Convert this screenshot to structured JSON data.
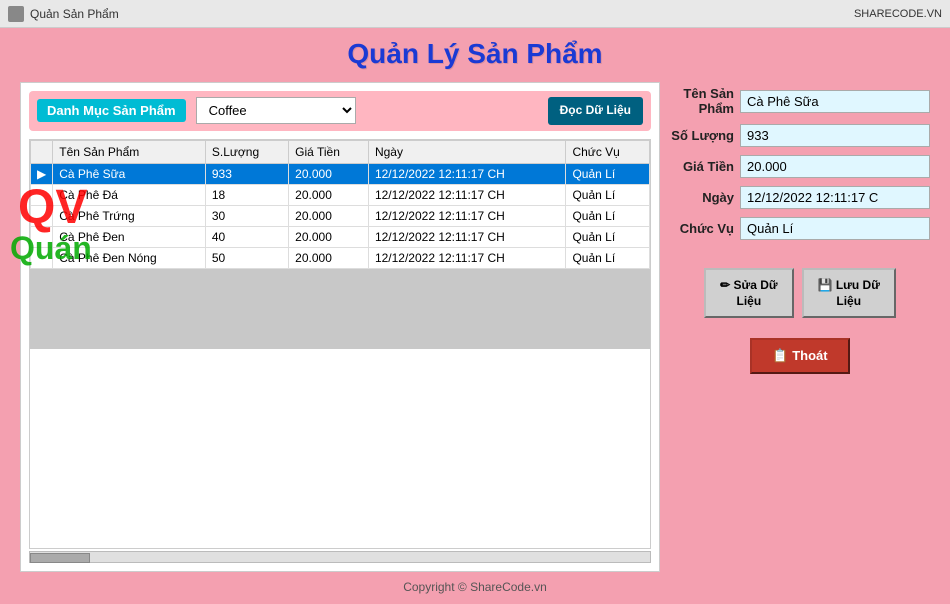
{
  "titlebar": {
    "title": "Quản Sản Phẩm",
    "logo_text": "SHARECODE.VN"
  },
  "page_title": "Quản Lý Sản Phẩm",
  "toolbar": {
    "danh_muc_label": "Danh Mục Sản Phẩm",
    "dropdown_value": "Coffee",
    "doc_du_lieu_line1": "Đọc Dữ",
    "doc_du_lieu_line2": "Liệu"
  },
  "table": {
    "columns": [
      "",
      "Tên Sản Phẩm",
      "S.Lượng",
      "Giá Tiền",
      "Ngày",
      "Chức Vụ"
    ],
    "rows": [
      {
        "arrow": "▶",
        "ten": "Cà Phê Sữa",
        "sl": "933",
        "gia": "20.000",
        "ngay": "12/12/2022 12:11:17 CH",
        "chuc_vu": "Quản Lí",
        "selected": true
      },
      {
        "arrow": "",
        "ten": "Cà Phê Đá",
        "sl": "18",
        "gia": "20.000",
        "ngay": "12/12/2022 12:11:17 CH",
        "chuc_vu": "Quản Lí",
        "selected": false
      },
      {
        "arrow": "",
        "ten": "Cà Phê Trứng",
        "sl": "30",
        "gia": "20.000",
        "ngay": "12/12/2022 12:11:17 CH",
        "chuc_vu": "Quản Lí",
        "selected": false
      },
      {
        "arrow": "",
        "ten": "Cà Phê Đen",
        "sl": "40",
        "gia": "20.000",
        "ngay": "12/12/2022 12:11:17 CH",
        "chuc_vu": "Quản Lí",
        "selected": false
      },
      {
        "arrow": "",
        "ten": "Cà Phê Đen Nóng",
        "sl": "50",
        "gia": "20.000",
        "ngay": "12/12/2022 12:11:17 CH",
        "chuc_vu": "Quản Lí",
        "selected": false
      }
    ]
  },
  "right_panel": {
    "fields": [
      {
        "label": "Tên Sản Phẩm",
        "value": "Cà Phê Sữa"
      },
      {
        "label": "Số Lượng",
        "value": "933"
      },
      {
        "label": "Giá Tiền",
        "value": "20.000"
      },
      {
        "label": "Ngày",
        "value": "12/12/2022 12:11:17 C"
      },
      {
        "label": "Chức Vụ",
        "value": "Quản Lí"
      }
    ],
    "sua_line1": "✏ Sửa Dữ",
    "sua_line2": "Liệu",
    "luu_line1": "💾 Lưu Dữ",
    "luu_line2": "Liệu",
    "thoat_label": "📋 Thoát"
  },
  "watermark": {
    "qv": "QV",
    "quan": "Quán"
  },
  "footer": {
    "text": "Copyright © ShareCode.vn"
  }
}
